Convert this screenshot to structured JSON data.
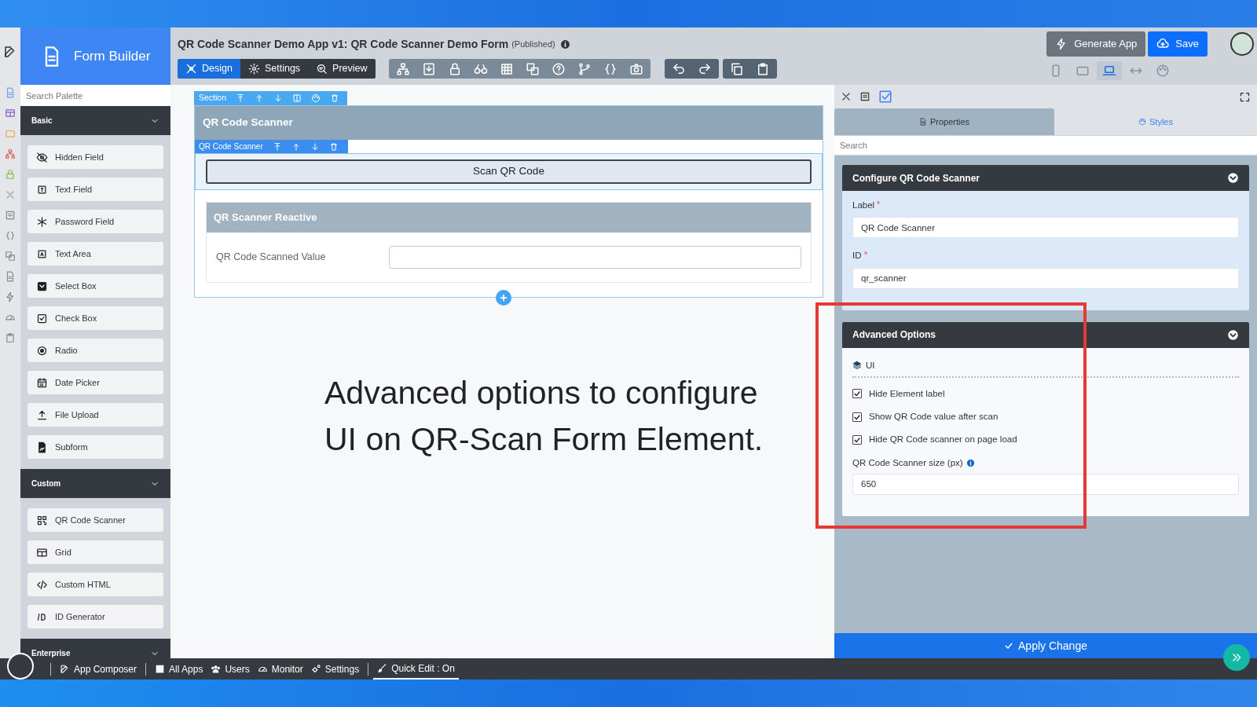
{
  "sidebar": {
    "title": "Form Builder",
    "search_placeholder": "Search Palette",
    "groups": [
      {
        "title": "Basic",
        "items": [
          {
            "label": "Hidden Field"
          },
          {
            "label": "Text Field"
          },
          {
            "label": "Password Field"
          },
          {
            "label": "Text Area"
          },
          {
            "label": "Select Box"
          },
          {
            "label": "Check Box"
          },
          {
            "label": "Radio"
          },
          {
            "label": "Date Picker"
          },
          {
            "label": "File Upload"
          },
          {
            "label": "Subform"
          }
        ]
      },
      {
        "title": "Custom",
        "items": [
          {
            "label": "QR Code Scanner"
          },
          {
            "label": "Grid"
          },
          {
            "label": "Custom HTML"
          },
          {
            "label": "ID Generator"
          }
        ]
      },
      {
        "title": "Enterprise"
      }
    ]
  },
  "header": {
    "title": "QR Code Scanner Demo App v1: QR Code Scanner Demo Form",
    "status": "(Published)",
    "mode_tabs": [
      {
        "label": "Design",
        "selected": true
      },
      {
        "label": "Settings",
        "selected": false
      },
      {
        "label": "Preview",
        "selected": false
      }
    ],
    "actions": [
      {
        "kind": "generate",
        "label": "Generate App"
      },
      {
        "kind": "save",
        "label": "Save"
      }
    ],
    "device_views": [
      {
        "selected": false
      },
      {
        "selected": false
      },
      {
        "selected": true
      },
      {
        "selected": false
      },
      {
        "selected": false
      }
    ]
  },
  "canvas": {
    "section_tag": "Section",
    "section_title": "QR Code Scanner",
    "element_tag": "QR Code Scanner",
    "scan_button": "Scan QR Code",
    "subsection_title": "QR Scanner Reactive",
    "field_label": "QR Code Scanned Value"
  },
  "caption": "Advanced options to configure UI on QR-Scan Form Element.",
  "properties_panel": {
    "tabs": [
      {
        "label": "Properties",
        "selected": true
      },
      {
        "label": "Styles",
        "selected": false
      }
    ],
    "search_placeholder": "Search",
    "configure": {
      "title": "Configure QR Code Scanner",
      "fields": [
        {
          "label": "Label",
          "required": true,
          "value": "QR Code Scanner"
        },
        {
          "label": "ID",
          "required": true,
          "value": "qr_scanner"
        }
      ]
    },
    "advanced": {
      "title": "Advanced Options",
      "group": "UI",
      "options": [
        {
          "label": "Hide Element label",
          "checked": true
        },
        {
          "label": "Show QR Code value after scan",
          "checked": true
        },
        {
          "label": "Hide QR Code scanner on page load",
          "checked": true
        }
      ],
      "size_label": "QR Code Scanner size (px)",
      "size_value": "650"
    },
    "apply_button": "Apply Change"
  },
  "taskbar": [
    {
      "label": "App Composer",
      "selected": false
    },
    {
      "label": "All Apps",
      "selected": false
    },
    {
      "label": "Users",
      "selected": false
    },
    {
      "label": "Monitor",
      "selected": false
    },
    {
      "label": "Settings",
      "selected": false
    },
    {
      "label": "Quick Edit : On",
      "selected": true
    }
  ]
}
